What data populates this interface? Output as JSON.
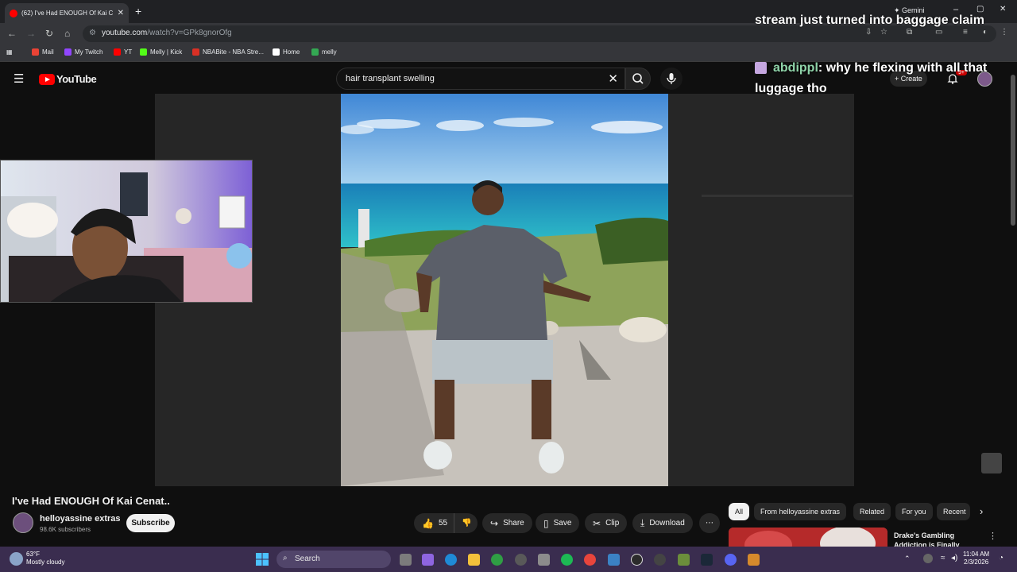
{
  "browser": {
    "tab_title": "(62) I've Had ENOUGH Of Kai C",
    "url_host": "youtube.com",
    "url_path": "/watch?v=GPk8gnorOfg",
    "bookmarks": [
      {
        "label": "Mail",
        "icon": "gmail-icon",
        "color": "#ea4335"
      },
      {
        "label": "My Twitch",
        "icon": "twitch-icon",
        "color": "#9146ff"
      },
      {
        "label": "YT",
        "icon": "youtube-icon",
        "color": "#ff0000"
      },
      {
        "label": "Melly | Kick",
        "icon": "kick-icon",
        "color": "#53fc18"
      },
      {
        "label": "NBABite - NBA Stre...",
        "icon": "nbabite-icon",
        "color": "#d93025"
      },
      {
        "label": "Home",
        "icon": "x-icon",
        "color": "#ffffff"
      },
      {
        "label": "melly",
        "icon": "melly-icon",
        "color": "#34a853"
      }
    ]
  },
  "youtube": {
    "logo_text": "YouTube",
    "search_value": "hair transplant swelling",
    "create_label": "Create",
    "notification_badge": "9+",
    "video_title": "I've Had ENOUGH Of Kai Cenat..",
    "channel_name": "helloyassine extras",
    "channel_subs": "98.6K subscribers",
    "subscribe_label": "Subscribe",
    "like_count": "55",
    "actions": {
      "share": "Share",
      "save": "Save",
      "clip": "Clip",
      "download": "Download"
    },
    "chips": [
      "All",
      "From helloyassine extras",
      "Related",
      "For you",
      "Recent"
    ],
    "related_title": "Drake's Gambling Addiction is Finally"
  },
  "chat": [
    {
      "user": "",
      "text": "stream just turned into baggage claim"
    },
    {
      "user": "abdippl",
      "text": ": why he flexing with all that luggage tho"
    }
  ],
  "taskbar": {
    "weather_temp": "63°F",
    "weather_desc": "Mostly cloudy",
    "search_label": "Search",
    "time": "11:04 AM",
    "date": "2/3/2026"
  },
  "colors": {
    "youtube_red": "#ff0000",
    "chat_user": "#8fd4a9",
    "taskbar": "#3a2d4f"
  }
}
